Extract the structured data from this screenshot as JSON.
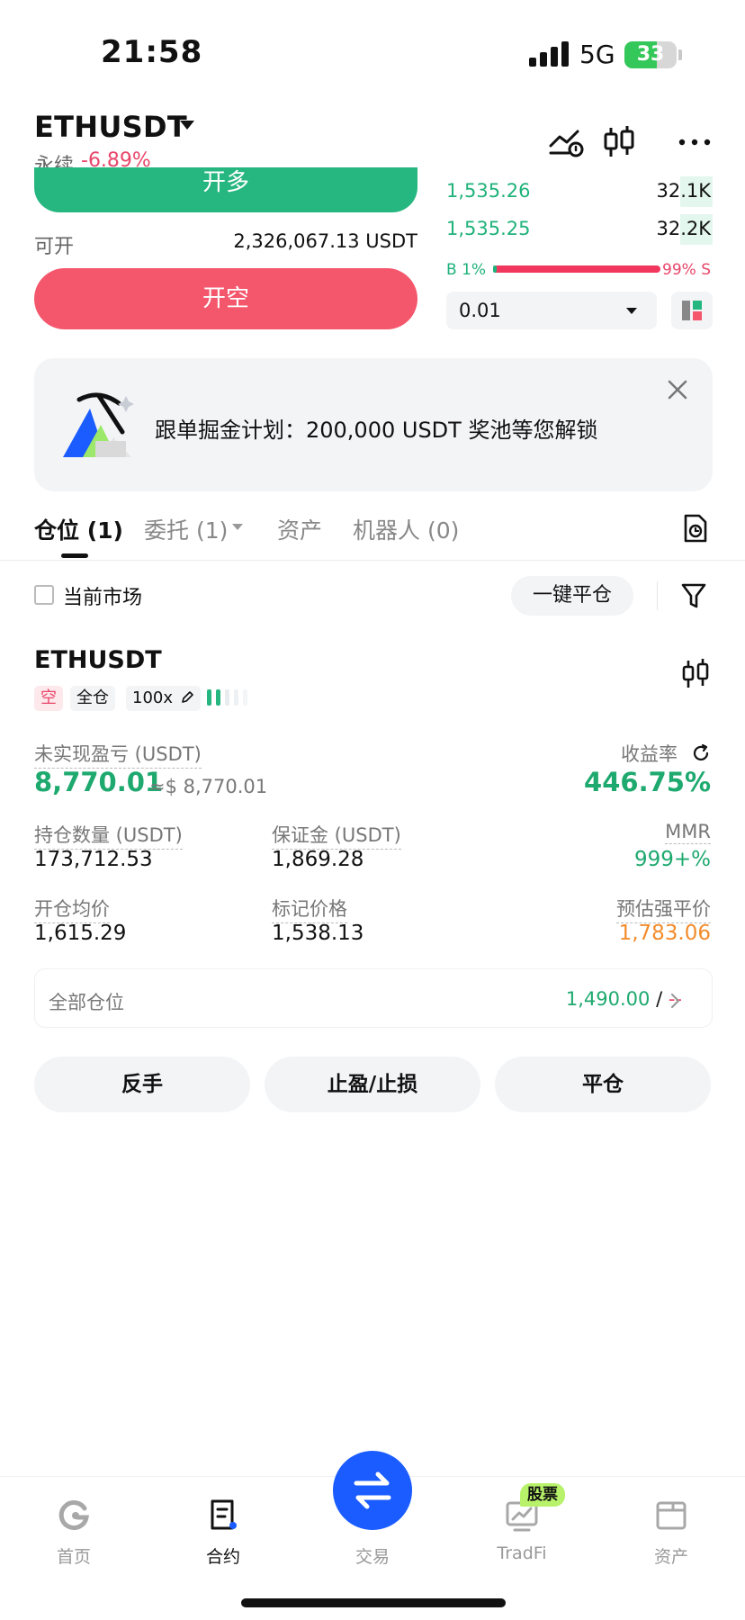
{
  "status_bar": {
    "time": "21:58",
    "network": "5G",
    "battery": "33"
  },
  "header": {
    "symbol": "ETHUSDT",
    "perp_label": "永续",
    "change": "-6.89%"
  },
  "order_panel": {
    "open_long": "开多",
    "available_label": "可开",
    "available_value": "2,326,067.13 USDT",
    "open_short": "开空"
  },
  "order_book": {
    "rows": [
      {
        "price": "1,535.26",
        "qty": "32.1K"
      },
      {
        "price": "1,535.25",
        "qty": "32.2K"
      }
    ],
    "buy_ratio": "B 1%",
    "sell_ratio": "99% S",
    "buy_ratio_value": 0.01,
    "depth_step": "0.01"
  },
  "promo": {
    "text": "跟单掘金计划：200,000 USDT 奖池等您解锁"
  },
  "tabs": [
    {
      "label": "仓位 (1)"
    },
    {
      "label": "委托 (1)"
    },
    {
      "label": "资产"
    },
    {
      "label": "机器人 (0)"
    }
  ],
  "filters": {
    "current_market": "当前市场",
    "close_all": "一键平仓"
  },
  "position": {
    "symbol": "ETHUSDT",
    "side_tag": "空",
    "margin_tag": "全仓",
    "leverage_tag": "100x",
    "unrealized_pnl_label": "未实现盈亏 (USDT)",
    "unrealized_pnl": "8,770.01",
    "unrealized_pnl_usd": "≈$ 8,770.01",
    "roe_label": "收益率",
    "roe": "446.75%",
    "size_label": "持仓数量 (USDT)",
    "size": "173,712.53",
    "margin_label": "保证金 (USDT)",
    "margin": "1,869.28",
    "mmr_label": "MMR",
    "mmr": "999+%",
    "entry_label": "开仓均价",
    "entry": "1,615.29",
    "mark_label": "标记价格",
    "mark": "1,538.13",
    "liq_label": "预估强平价",
    "liq": "1,783.06",
    "all_positions_label": "全部仓位",
    "all_positions_value": "1,490.00",
    "all_positions_sep": "/",
    "all_positions_other": "--"
  },
  "actions": {
    "reverse": "反手",
    "tpsl": "止盈/止损",
    "close": "平仓"
  },
  "bottom_nav": [
    {
      "label": "首页"
    },
    {
      "label": "合约"
    },
    {
      "label": "交易"
    },
    {
      "label": "TradFi",
      "badge": "股票"
    },
    {
      "label": "资产"
    }
  ],
  "colors": {
    "long": "#26b67f",
    "short": "#f4566c",
    "accent": "#1a5cff",
    "badge": "#b8f26a"
  }
}
